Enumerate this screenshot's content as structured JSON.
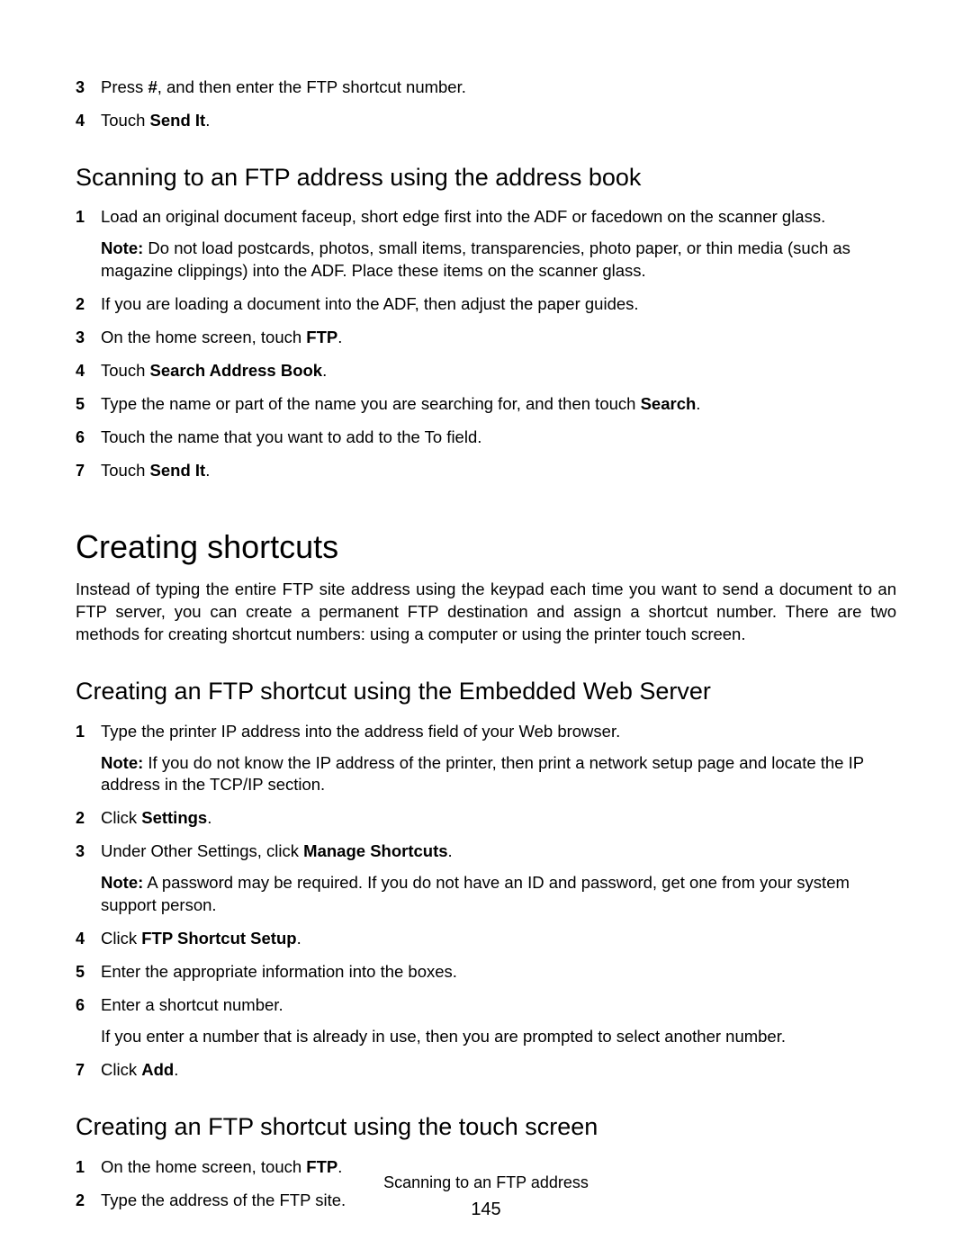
{
  "top_steps": [
    {
      "num": "3",
      "segments": [
        {
          "t": "Press "
        },
        {
          "t": "#",
          "b": true
        },
        {
          "t": ", and then enter the FTP shortcut number."
        }
      ]
    },
    {
      "num": "4",
      "segments": [
        {
          "t": "Touch "
        },
        {
          "t": "Send It",
          "b": true
        },
        {
          "t": "."
        }
      ]
    }
  ],
  "sub1": {
    "heading": "Scanning to an FTP address using the address book",
    "steps": [
      {
        "num": "1",
        "segments": [
          {
            "t": "Load an original document faceup, short edge first into the ADF or facedown on the scanner glass."
          }
        ],
        "after": [
          {
            "segments": [
              {
                "t": "Note:",
                "b": true
              },
              {
                "t": " Do not load postcards, photos, small items, transparencies, photo paper, or thin media (such as magazine clippings) into the ADF. Place these items on the scanner glass."
              }
            ]
          }
        ]
      },
      {
        "num": "2",
        "segments": [
          {
            "t": "If you are loading a document into the ADF, then adjust the paper guides."
          }
        ]
      },
      {
        "num": "3",
        "segments": [
          {
            "t": "On the home screen, touch "
          },
          {
            "t": "FTP",
            "b": true
          },
          {
            "t": "."
          }
        ]
      },
      {
        "num": "4",
        "segments": [
          {
            "t": "Touch "
          },
          {
            "t": "Search Address Book",
            "b": true
          },
          {
            "t": "."
          }
        ]
      },
      {
        "num": "5",
        "segments": [
          {
            "t": "Type the name or part of the name you are searching for, and then touch "
          },
          {
            "t": "Search",
            "b": true
          },
          {
            "t": "."
          }
        ]
      },
      {
        "num": "6",
        "segments": [
          {
            "t": "Touch the name that you want to add to the To field."
          }
        ]
      },
      {
        "num": "7",
        "segments": [
          {
            "t": "Touch "
          },
          {
            "t": "Send It",
            "b": true
          },
          {
            "t": "."
          }
        ]
      }
    ]
  },
  "section2": {
    "heading": "Creating shortcuts",
    "intro": "Instead of typing the entire FTP site address using the keypad each time you want to send a document to an FTP server, you can create a permanent FTP destination and assign a shortcut number. There are two methods for creating shortcut numbers: using a computer or using the printer touch screen."
  },
  "sub2a": {
    "heading": "Creating an FTP shortcut using the Embedded Web Server",
    "steps": [
      {
        "num": "1",
        "segments": [
          {
            "t": "Type the printer IP address into the address field of your Web browser."
          }
        ],
        "after": [
          {
            "segments": [
              {
                "t": "Note:",
                "b": true
              },
              {
                "t": " If you do not know the IP address of the printer, then print a network setup page and locate the IP address in the TCP/IP section."
              }
            ]
          }
        ]
      },
      {
        "num": "2",
        "segments": [
          {
            "t": "Click "
          },
          {
            "t": "Settings",
            "b": true
          },
          {
            "t": "."
          }
        ]
      },
      {
        "num": "3",
        "segments": [
          {
            "t": "Under Other Settings, click "
          },
          {
            "t": "Manage Shortcuts",
            "b": true
          },
          {
            "t": "."
          }
        ],
        "after": [
          {
            "segments": [
              {
                "t": "Note:",
                "b": true
              },
              {
                "t": " A password may be required. If you do not have an ID and password, get one from your system support person."
              }
            ]
          }
        ]
      },
      {
        "num": "4",
        "segments": [
          {
            "t": "Click "
          },
          {
            "t": "FTP Shortcut Setup",
            "b": true
          },
          {
            "t": "."
          }
        ]
      },
      {
        "num": "5",
        "segments": [
          {
            "t": "Enter the appropriate information into the boxes."
          }
        ]
      },
      {
        "num": "6",
        "segments": [
          {
            "t": "Enter a shortcut number."
          }
        ],
        "after": [
          {
            "segments": [
              {
                "t": "If you enter a number that is already in use, then you are prompted to select another number."
              }
            ]
          }
        ]
      },
      {
        "num": "7",
        "segments": [
          {
            "t": "Click "
          },
          {
            "t": "Add",
            "b": true
          },
          {
            "t": "."
          }
        ]
      }
    ]
  },
  "sub2b": {
    "heading": "Creating an FTP shortcut using the touch screen",
    "steps": [
      {
        "num": "1",
        "segments": [
          {
            "t": "On the home screen, touch "
          },
          {
            "t": "FTP",
            "b": true
          },
          {
            "t": "."
          }
        ]
      },
      {
        "num": "2",
        "segments": [
          {
            "t": "Type the address of the FTP site."
          }
        ]
      }
    ]
  },
  "footer": {
    "title": "Scanning to an FTP address",
    "page": "145"
  }
}
